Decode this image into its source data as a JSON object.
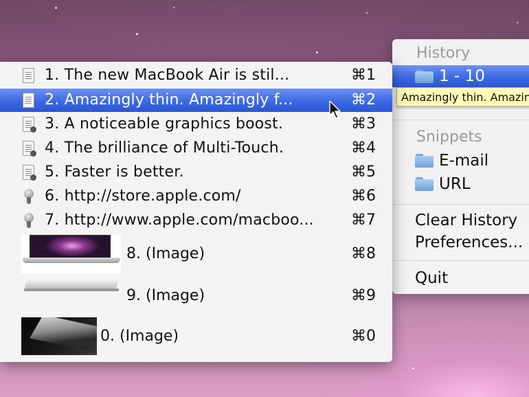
{
  "parent_menu": {
    "history_header": "History",
    "history_range": "1 - 10",
    "snippets_header": "Snippets",
    "snippet_folders": [
      "E-mail",
      "URL"
    ],
    "clear_history": "Clear History",
    "preferences": "Preferences...",
    "quit": "Quit"
  },
  "tooltip": "Amazingly thin. Amazingly f",
  "history_items": [
    {
      "label": "1. The new MacBook Air is stil...",
      "shortcut": "⌘1",
      "icon": "text-clipping-icon"
    },
    {
      "label": "2. Amazingly thin. Amazingly f...",
      "shortcut": "⌘2",
      "icon": "text-clipping-icon",
      "selected": true
    },
    {
      "label": "3. A noticeable graphics boost.",
      "shortcut": "⌘3",
      "icon": "rich-text-clipping-icon"
    },
    {
      "label": "4. The brilliance of Multi-Touch.",
      "shortcut": "⌘4",
      "icon": "rich-text-clipping-icon"
    },
    {
      "label": "5. Faster is better.",
      "shortcut": "⌘5",
      "icon": "rich-text-clipping-icon"
    },
    {
      "label": "6. http://store.apple.com/",
      "shortcut": "⌘6",
      "icon": "url-clipping-icon"
    },
    {
      "label": "7. http://www.apple.com/macboo...",
      "shortcut": "⌘7",
      "icon": "url-clipping-icon"
    }
  ],
  "image_items": [
    {
      "label": "8. (Image)",
      "shortcut": "⌘8",
      "thumb": "macbook-open-thumbnail"
    },
    {
      "label": "9. (Image)",
      "shortcut": "⌘9",
      "thumb": "macbook-closed-thumbnail"
    },
    {
      "label": "0. (Image)",
      "shortcut": "⌘0",
      "thumb": "macbook-dark-thumbnail"
    }
  ]
}
